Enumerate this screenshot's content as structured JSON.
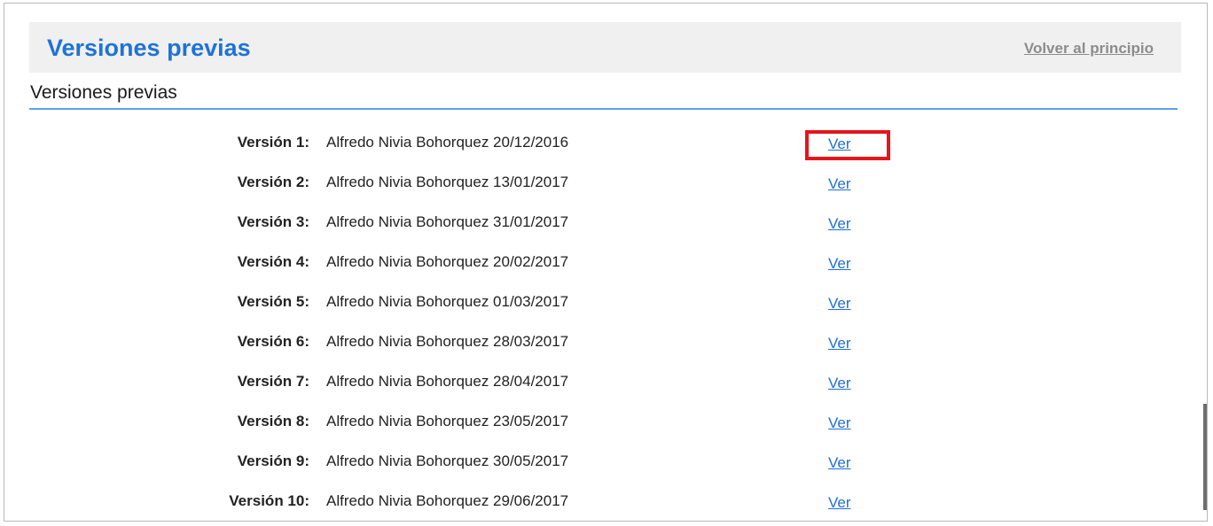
{
  "header": {
    "title": "Versiones previas",
    "back_link": "Volver al principio"
  },
  "section": {
    "subtitle": "Versiones previas"
  },
  "versions": [
    {
      "label": "Versión 1:",
      "desc": "Alfredo Nivia Bohorquez 20/12/2016",
      "link": "Ver"
    },
    {
      "label": "Versión 2:",
      "desc": "Alfredo Nivia Bohorquez 13/01/2017",
      "link": "Ver"
    },
    {
      "label": "Versión 3:",
      "desc": "Alfredo Nivia Bohorquez 31/01/2017",
      "link": "Ver"
    },
    {
      "label": "Versión 4:",
      "desc": "Alfredo Nivia Bohorquez 20/02/2017",
      "link": "Ver"
    },
    {
      "label": "Versión 5:",
      "desc": "Alfredo Nivia Bohorquez 01/03/2017",
      "link": "Ver"
    },
    {
      "label": "Versión 6:",
      "desc": "Alfredo Nivia Bohorquez 28/03/2017",
      "link": "Ver"
    },
    {
      "label": "Versión 7:",
      "desc": "Alfredo Nivia Bohorquez 28/04/2017",
      "link": "Ver"
    },
    {
      "label": "Versión 8:",
      "desc": "Alfredo Nivia Bohorquez 23/05/2017",
      "link": "Ver"
    },
    {
      "label": "Versión 9:",
      "desc": "Alfredo Nivia Bohorquez 30/05/2017",
      "link": "Ver"
    },
    {
      "label": "Versión 10:",
      "desc": "Alfredo Nivia Bohorquez 29/06/2017",
      "link": "Ver"
    }
  ],
  "colors": {
    "title": "#1e73d6",
    "link": "#1e6fd9",
    "rule": "#5ea2e8",
    "highlight": "#e8141b"
  }
}
